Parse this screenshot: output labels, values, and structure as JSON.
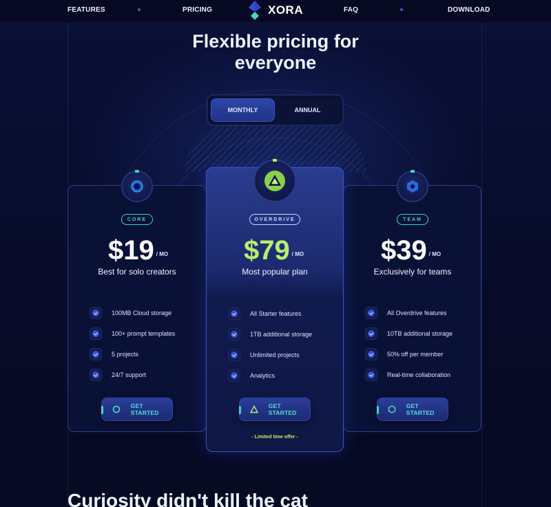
{
  "nav": {
    "features": "FEATURES",
    "pricing": "PRICING",
    "logo_text": "XORA",
    "faq": "FAQ",
    "download": "DOWNLOAD"
  },
  "hero": {
    "heading_line1": "Flexible pricing for",
    "heading_line2": "everyone"
  },
  "billing_toggle": {
    "monthly": "MONTHLY",
    "annual": "ANNUAL",
    "selected": "MONTHLY"
  },
  "plans": [
    {
      "name": "CORE",
      "icon": "core-ring-icon",
      "price": "$19",
      "period": "/ MO",
      "tagline": "Best for solo creators",
      "features": [
        "100MB Cloud storage",
        "100+ prompt templates",
        "5 projects",
        "24/7 support"
      ],
      "cta": "GET STARTED"
    },
    {
      "name": "OVERDRIVE",
      "icon": "overdrive-triangle-icon",
      "price": "$79",
      "period": "/ MO",
      "tagline": "Most popular plan",
      "features": [
        "All Starter features",
        "1TB additional storage",
        "Unlimited projects",
        "Analytics"
      ],
      "cta": "GET STARTED",
      "offer": "- Limited time offer -"
    },
    {
      "name": "TEAM",
      "icon": "team-hexagon-icon",
      "price": "$39",
      "period": "/ MO",
      "tagline": "Exclusively for teams",
      "features": [
        "All Overdrive features",
        "10TB additional storage",
        "50% off per member",
        "Real-time collaboration"
      ],
      "cta": "GET STARTED"
    }
  ],
  "next_section": {
    "heading": "Curiosity didn't kill the cat"
  },
  "colors": {
    "accent_teal": "#3ed6c8",
    "accent_green": "#b7ef6a",
    "primary_blue": "#3552d6",
    "background": "#070b24"
  }
}
